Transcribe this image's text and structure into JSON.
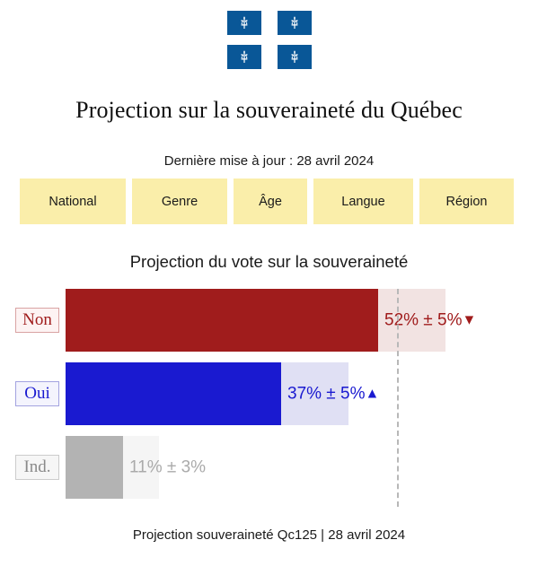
{
  "header": {
    "flags": [
      {
        "name": "quebec-flag-1"
      },
      {
        "name": "quebec-flag-2"
      },
      {
        "name": "quebec-flag-3"
      },
      {
        "name": "quebec-flag-4"
      }
    ],
    "flag_color": "#095797",
    "title": "Projection sur la souveraineté du Québec",
    "subtitle": "Dernière mise à jour : 28 avril 2024"
  },
  "tabs": {
    "items": [
      {
        "label": "National"
      },
      {
        "label": "Genre"
      },
      {
        "label": "Âge"
      },
      {
        "label": "Langue"
      },
      {
        "label": "Région"
      }
    ],
    "background_color": "#faeeaa"
  },
  "chart_data": {
    "type": "bar",
    "title": "Projection du vote sur la souveraineté",
    "orientation": "horizontal",
    "xlabel": "",
    "ylabel": "",
    "xlim": [
      0,
      60
    ],
    "grid": false,
    "legend": "none",
    "reference_line": {
      "value": 50,
      "style": "dashed",
      "color": "#b8b8b8"
    },
    "categories": [
      "Non",
      "Oui",
      "Ind."
    ],
    "values": [
      52,
      37,
      11
    ],
    "errors": [
      5,
      5,
      3
    ],
    "value_labels": [
      "52% ± 5%",
      "37% ± 5%",
      "11% ± 3%"
    ],
    "trends": [
      "▼",
      "▲",
      ""
    ],
    "colors": [
      "#a01c1c",
      "#1a1ad0",
      "#b3b3b3"
    ],
    "ci_colors": [
      "#f2e3e2",
      "#e0e0f4",
      "#f5f5f5"
    ],
    "series": [
      {
        "name": "Projection du vote",
        "values": [
          52,
          37,
          11
        ]
      }
    ]
  },
  "bars": [
    {
      "label": "Non",
      "value_text": "52% ± 5%",
      "trend": "▼"
    },
    {
      "label": "Oui",
      "value_text": "37% ± 5%",
      "trend": "▲"
    },
    {
      "label": "Ind.",
      "value_text": "11% ± 3%",
      "trend": ""
    }
  ],
  "footer": {
    "text": "Projection souveraineté Qc125 | 28 avril 2024"
  }
}
